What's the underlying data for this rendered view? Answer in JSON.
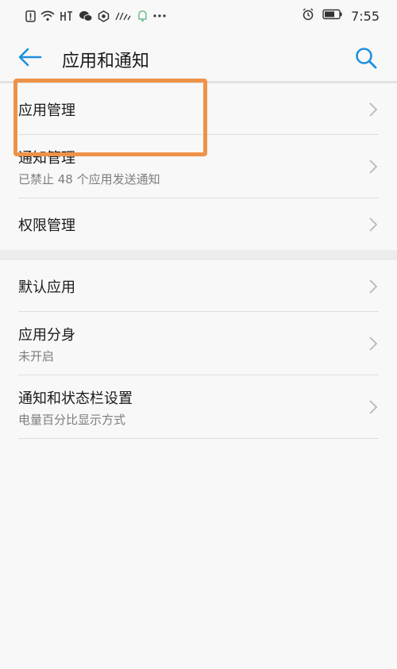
{
  "status_bar": {
    "time": "7:55",
    "icons": [
      "alert-icon",
      "wifi-icon",
      "hd-icon",
      "wechat-icon",
      "app-icon",
      "signal-speed-icon",
      "notification-icon",
      "more-icon",
      "alarm-icon",
      "battery-icon"
    ]
  },
  "header": {
    "title": "应用和通知",
    "back_icon": "back-arrow-icon",
    "search_icon": "search-icon"
  },
  "group1": [
    {
      "title": "应用管理",
      "subtitle": ""
    },
    {
      "title": "通知管理",
      "subtitle": "已禁止 48 个应用发送通知"
    },
    {
      "title": "权限管理",
      "subtitle": ""
    }
  ],
  "group2": [
    {
      "title": "默认应用",
      "subtitle": ""
    },
    {
      "title": "应用分身",
      "subtitle": "未开启"
    },
    {
      "title": "通知和状态栏设置",
      "subtitle": "电量百分比显示方式"
    }
  ],
  "colors": {
    "accent": "#1f8fe0",
    "highlight": "#ee9248",
    "background": "#f8f8f8"
  }
}
